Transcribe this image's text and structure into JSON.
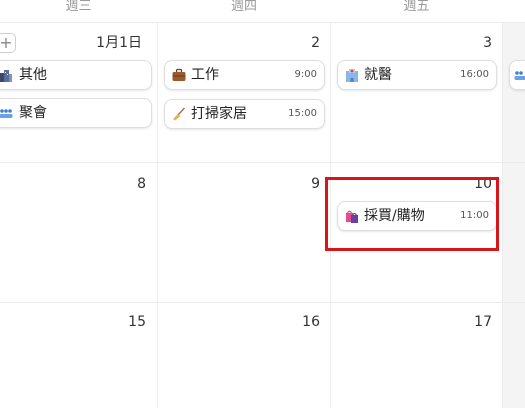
{
  "weekdays": [
    "週三",
    "週四",
    "週五"
  ],
  "days": {
    "w1": [
      "1月1日",
      "2",
      "3"
    ],
    "w2": [
      "8",
      "9",
      "10"
    ],
    "w3": [
      "15",
      "16",
      "17"
    ]
  },
  "add_button_label": "+",
  "events": [
    {
      "title": "其他",
      "time": "",
      "icon": "city-icon"
    },
    {
      "title": "聚會",
      "time": "",
      "icon": "people-icon"
    },
    {
      "title": "工作",
      "time": "9:00",
      "icon": "briefcase-icon"
    },
    {
      "title": "打掃家居",
      "time": "15:00",
      "icon": "broom-icon"
    },
    {
      "title": "就醫",
      "time": "16:00",
      "icon": "hospital-icon"
    },
    {
      "title": "採買/購物",
      "time": "11:00",
      "icon": "shopping-bags-icon"
    }
  ],
  "colors": {
    "highlight": "#d9141b",
    "weekend_bg": "#f4f4f4",
    "grid_line": "#ececec"
  }
}
